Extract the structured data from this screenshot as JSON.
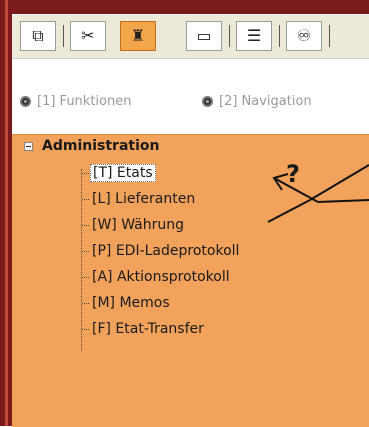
{
  "toolbar": {
    "tabs": [
      {
        "icon": "window-icon",
        "glyph": "⧉"
      },
      {
        "icon": "cut-icon",
        "glyph": "✂"
      },
      {
        "icon": "trash-icon",
        "glyph": "♜"
      },
      {
        "icon": "folder-icon",
        "glyph": "▭"
      },
      {
        "icon": "list-icon",
        "glyph": "☰"
      },
      {
        "icon": "binoculars-icon",
        "glyph": "♾"
      }
    ],
    "active_index": 2
  },
  "radio": {
    "option1": "[1] Funktionen",
    "option2": "[2] Navigation"
  },
  "tree": {
    "root": "Administration",
    "items": [
      "[T] Etats",
      "[L] Lieferanten",
      "[W] Währung",
      "[P] EDI-Ladeprotokoll",
      "[A] Aktionsprotokoll",
      "[M] Memos",
      "[F] Etat-Transfer"
    ],
    "selected_index": 0
  },
  "annotation": {
    "question_mark": "?"
  },
  "colors": {
    "frame": "#7a1a1a",
    "panel": "#f2a25a",
    "active_tab": "#f2a54a"
  }
}
